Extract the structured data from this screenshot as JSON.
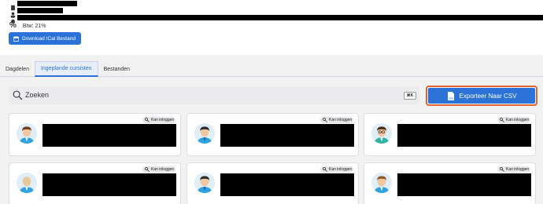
{
  "header": {
    "btw_label": "Btw: 21%",
    "btw_icon": "percent-icon",
    "ical_button_label": "Download ICal Bestand",
    "ical_icon": "calendar-icon"
  },
  "tabs": [
    {
      "label": "Dagdelen",
      "active": false
    },
    {
      "label": "Ingeplande cursisten",
      "active": true
    },
    {
      "label": "Bestanden",
      "active": false
    }
  ],
  "search": {
    "placeholder": "Zoeken",
    "shortcut": "⌘K"
  },
  "export_button": {
    "label": "Exporteer Naar CSV",
    "icon": "csv-file-icon"
  },
  "cards": [
    {
      "badge": "Kan inloggen",
      "avatar": "male-avatar-icon"
    },
    {
      "badge": "Kan inloggen",
      "avatar": "male-avatar-icon"
    },
    {
      "badge": "Kan inloggen",
      "avatar": "male-avatar-glasses-icon"
    },
    {
      "badge": "Kan inloggen",
      "avatar": "bald-avatar-icon"
    },
    {
      "badge": "Kan inloggen",
      "avatar": "male-avatar-icon"
    },
    {
      "badge": "Kan inloggen",
      "avatar": "male-avatar-icon"
    }
  ],
  "colors": {
    "accent": "#2a72d8",
    "focus_ring": "#e06535",
    "background": "#f2f2f3"
  }
}
